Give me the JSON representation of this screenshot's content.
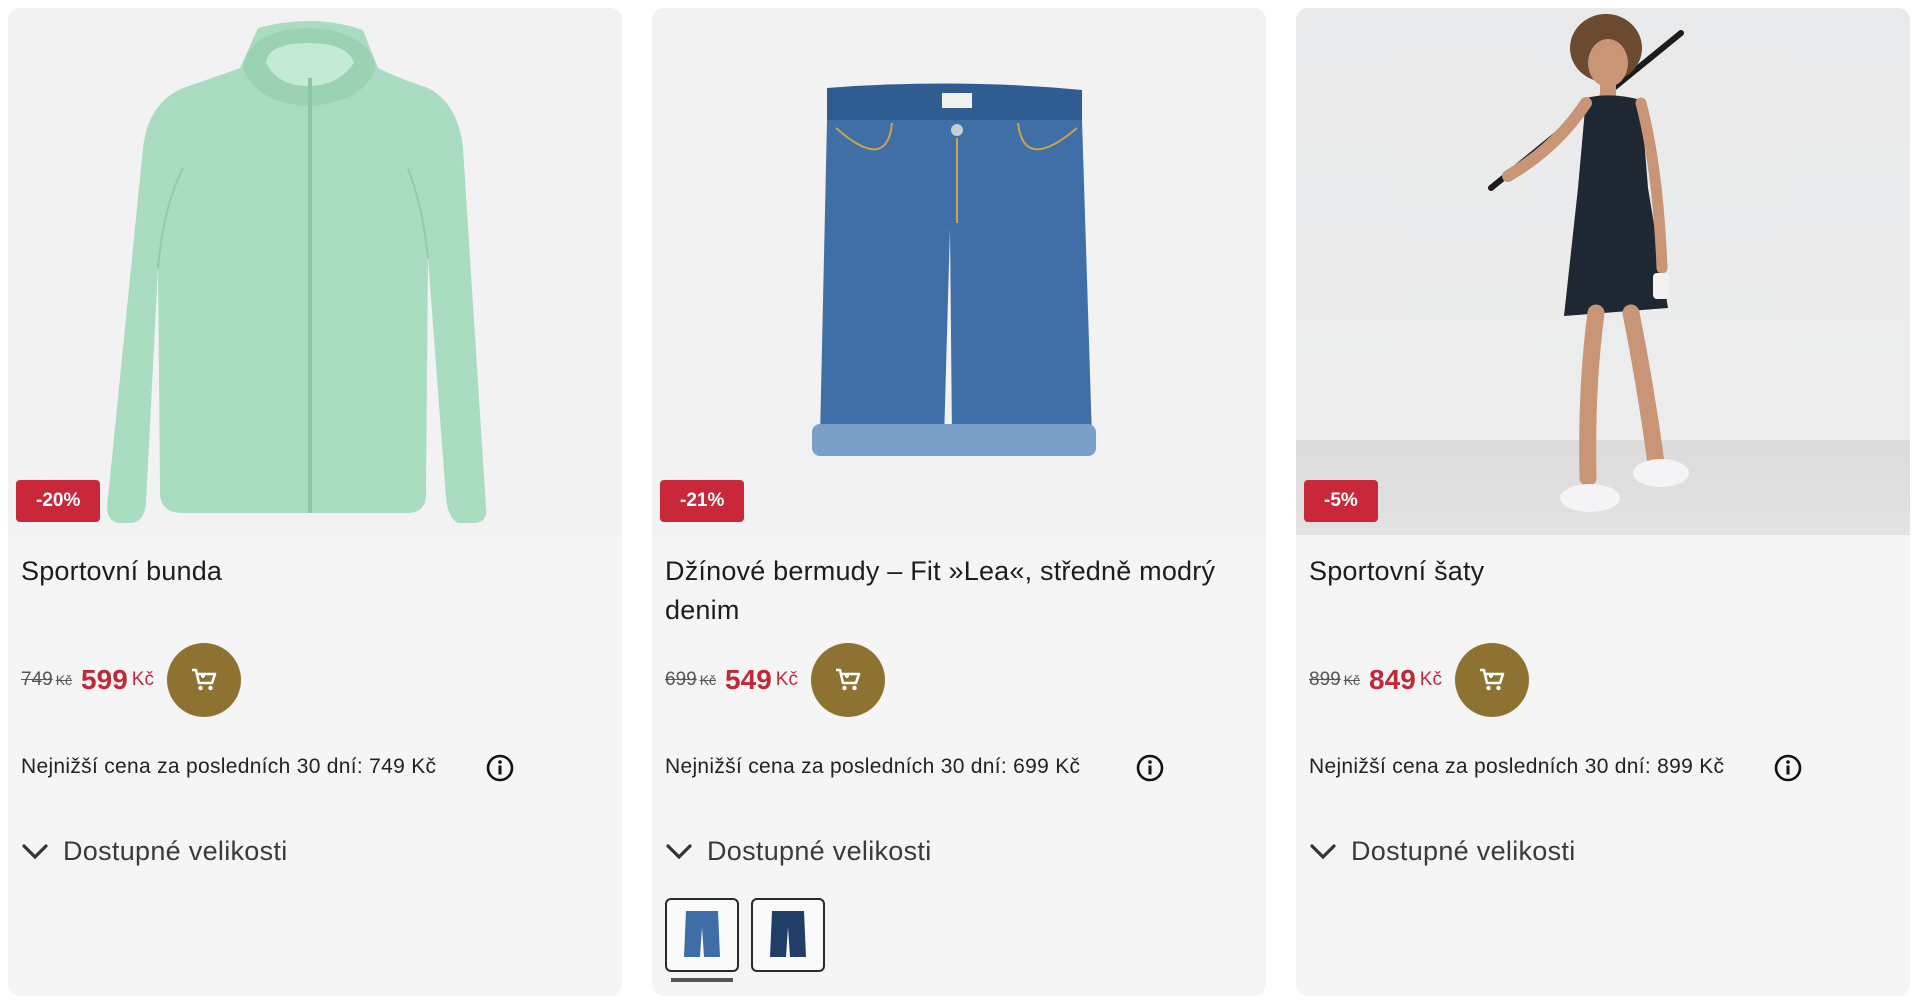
{
  "products": [
    {
      "title": "Sportovní bunda",
      "discount": "-20%",
      "old_price": "749",
      "old_currency": "Kč",
      "new_price": "599",
      "new_currency": "Kč",
      "lowest_price_text": "Nejnižší cena za posledních 30 dní: 749 Kč",
      "sizes_label": "Dostupné velikosti",
      "image_icon": "mint-zip-hoodie-image"
    },
    {
      "title": "Džínové bermudy – Fit »Lea«, středně modrý denim",
      "discount": "-21%",
      "old_price": "699",
      "old_currency": "Kč",
      "new_price": "549",
      "new_currency": "Kč",
      "lowest_price_text": "Nejnižší cena za posledních 30 dní: 699 Kč",
      "sizes_label": "Dostupné velikosti",
      "image_icon": "denim-bermuda-shorts-image",
      "variants": [
        "medium-blue-denim-variant",
        "dark-blue-denim-variant"
      ]
    },
    {
      "title": "Sportovní šaty",
      "discount": "-5%",
      "old_price": "899",
      "old_currency": "Kč",
      "new_price": "849",
      "new_currency": "Kč",
      "lowest_price_text": "Nejnižší cena za posledních 30 dní: 899 Kč",
      "sizes_label": "Dostupné velikosti",
      "image_icon": "golf-dress-model-image"
    }
  ],
  "colors": {
    "badge": "#c8283a",
    "sale_price": "#c0293a",
    "cart_button": "#8d7231",
    "card_background": "#f5f5f5"
  },
  "icons": {
    "cart": "cart-icon",
    "info": "info-icon",
    "chevron": "chevron-down-icon"
  }
}
